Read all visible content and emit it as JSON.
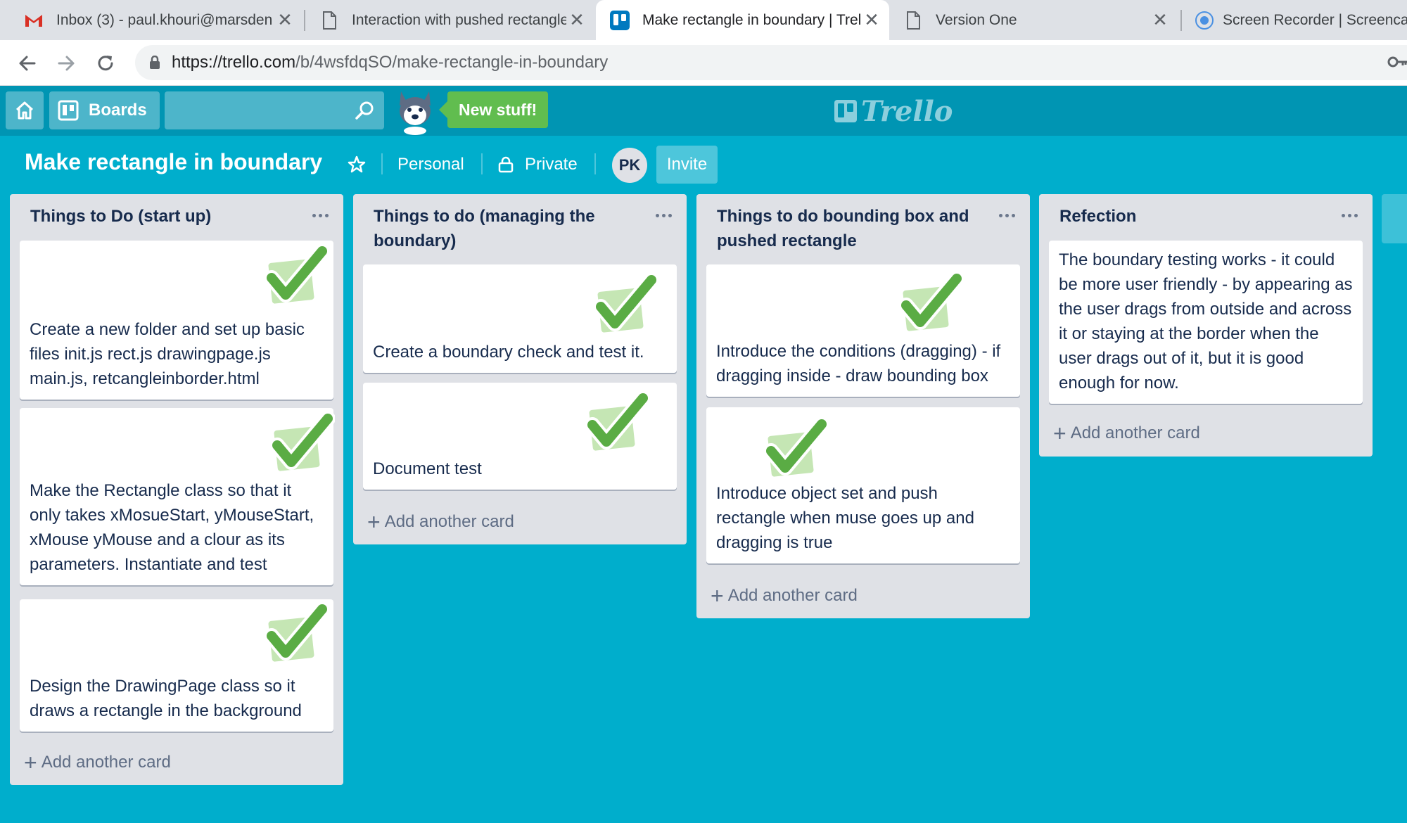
{
  "browser": {
    "tabs": [
      {
        "title": "Inbox (3) - paul.khouri@marsden",
        "icon": "gmail-icon"
      },
      {
        "title": "Interaction with pushed rectangle",
        "icon": "page-icon"
      },
      {
        "title": "Make rectangle in boundary | Trello",
        "icon": "trello-icon",
        "active": true
      },
      {
        "title": "Version One",
        "icon": "page-icon"
      },
      {
        "title": "Screen Recorder | Screencast",
        "icon": "recorder-icon"
      }
    ],
    "url": "https://trello.com/b/4wsfdqSO/make-rectangle-in-boundary",
    "url_host": "https://trello.com",
    "url_path": "/b/4wsfdqSO/make-rectangle-in-boundary"
  },
  "header": {
    "boards_label": "Boards",
    "search_placeholder": "",
    "new_stuff_label": "New stuff!",
    "logo_text": "Trello"
  },
  "board": {
    "title": "Make rectangle in boundary",
    "team": "Personal",
    "visibility": "Private",
    "member_initials": "PK",
    "invite_label": "Invite"
  },
  "lists": [
    {
      "title": "Things to Do (start up)",
      "cards": [
        {
          "text": "Create a new folder and set up basic files init.js rect.js drawingpage.js main.js, retcangleinborder.html",
          "sticker": "check"
        },
        {
          "text": "Make the Rectangle class so that it only takes xMosueStart, yMouseStart, xMouse yMouse and a clour as its parameters. Instantiate and test",
          "sticker": "check"
        },
        {
          "text": "Design the DrawingPage class so it draws a rectangle in the background",
          "sticker": "check"
        }
      ],
      "add_card_label": "Add another card"
    },
    {
      "title": "Things to do (managing the boundary)",
      "cards": [
        {
          "text": "Create a boundary check and test it.",
          "sticker": "check"
        },
        {
          "text": "Document test",
          "sticker": "check"
        }
      ],
      "add_card_label": "Add another card"
    },
    {
      "title": "Things to do bounding box and pushed rectangle",
      "cards": [
        {
          "text": "Introduce the conditions (dragging) - if dragging inside - draw bounding box",
          "sticker": "check"
        },
        {
          "text": "Introduce object set and push rectangle when muse goes up and dragging is true",
          "sticker": "check"
        }
      ],
      "add_card_label": "Add another card"
    },
    {
      "title": "Refection",
      "cards": [
        {
          "text": "The boundary testing works - it could be more user friendly - by appearing as the user drags from outside and across it or staying at the border when the user drags out of it, but it is good enough for now."
        }
      ],
      "add_card_label": "Add another card"
    }
  ],
  "colors": {
    "board_background": "#00aecc",
    "header_background": "#0095b3",
    "new_stuff_green": "#61bd4f",
    "list_background": "#dfe1e6",
    "sticker_green": "#5aac44"
  }
}
